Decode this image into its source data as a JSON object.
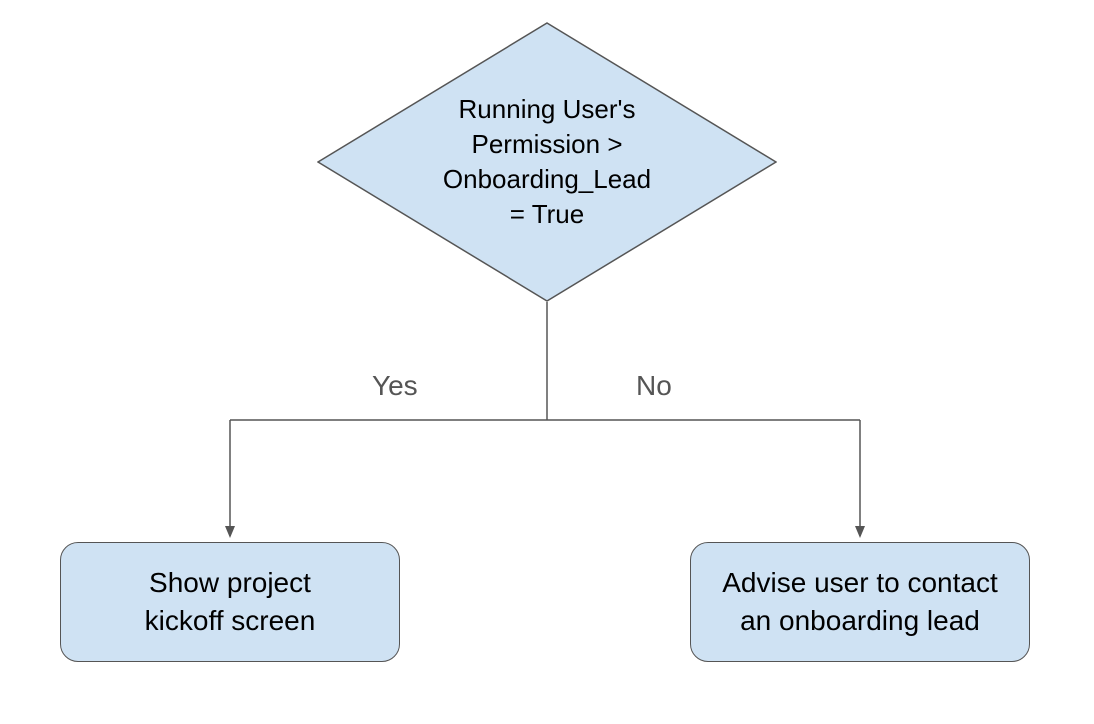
{
  "decision": {
    "line1": "Running User's",
    "line2": "Permission >",
    "line3": "Onboarding_Lead",
    "line4": "= True"
  },
  "branches": {
    "yes_label": "Yes",
    "no_label": "No"
  },
  "outcomes": {
    "left_line1": "Show project",
    "left_line2": "kickoff screen",
    "right_line1": "Advise user to contact",
    "right_line2": "an onboarding lead"
  },
  "colors": {
    "node_fill": "#cfe2f3",
    "node_stroke": "#555555",
    "arrow_stroke": "#555555",
    "text": "#000000",
    "label": "#555555"
  }
}
